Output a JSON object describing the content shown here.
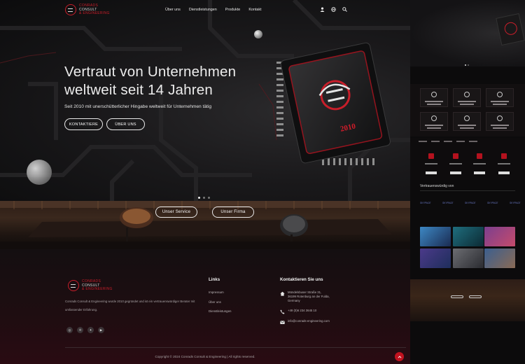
{
  "brand": {
    "line1": "CONRADS",
    "line2": "CONSULT",
    "line3": "& ENGINEERING"
  },
  "nav": {
    "items": [
      "Über uns",
      "Dienstleistungen",
      "Produkte",
      "Kontakt"
    ],
    "icons": [
      "user-icon",
      "globe-icon",
      "search-icon"
    ]
  },
  "hero": {
    "title": "Vertraut von Unternehmen weltweit seit 14 Jahren",
    "subtitle": "Seit 2010 mit unerschütterlicher Hingabe weltweit für Unternehmen tätig",
    "btn_contact": "KONTAKTIERE",
    "btn_about": "ÜBER UNS",
    "chip_year": "2010",
    "slides": 3,
    "active_slide": 1
  },
  "office": {
    "btn_service": "Unser Service",
    "btn_firm": "Unser Firma"
  },
  "footer": {
    "description": "Conrads Consult & Engineering wurde 2010 gegründet und ist ein vertrauenswürdiger Berater mit umfassender Erfahrung.",
    "social": [
      "instagram-icon",
      "pinterest-icon",
      "twitter-icon",
      "youtube-icon"
    ],
    "links_title": "Links",
    "links": [
      "Impressum",
      "Über uns",
      "Dienstleistungen"
    ],
    "contact_title": "Kontaktieren Sie uns",
    "address_line1": "Mündelsbuser Straße 31,",
    "address_line2": "36199 Rotenburg an der Fulda,",
    "address_line3": "Germany",
    "phone": "+49 (0)6 234 3645 10",
    "email": "info@conrads-engineering.com",
    "copyright": "Copyright © 2024 Conrads Consult & Engineering | All rights reserved."
  },
  "preview": {
    "trust_title": "Vertrauenswürdig von",
    "brand_logo": "SKYPACE",
    "colors": {
      "accent": "#c1121f",
      "thumb_blue": "#3d88c4",
      "thumb_teal": "#1f6e7e",
      "thumb_purple": "#7c3f8f",
      "thumb_gray": "#6c6d72"
    }
  }
}
